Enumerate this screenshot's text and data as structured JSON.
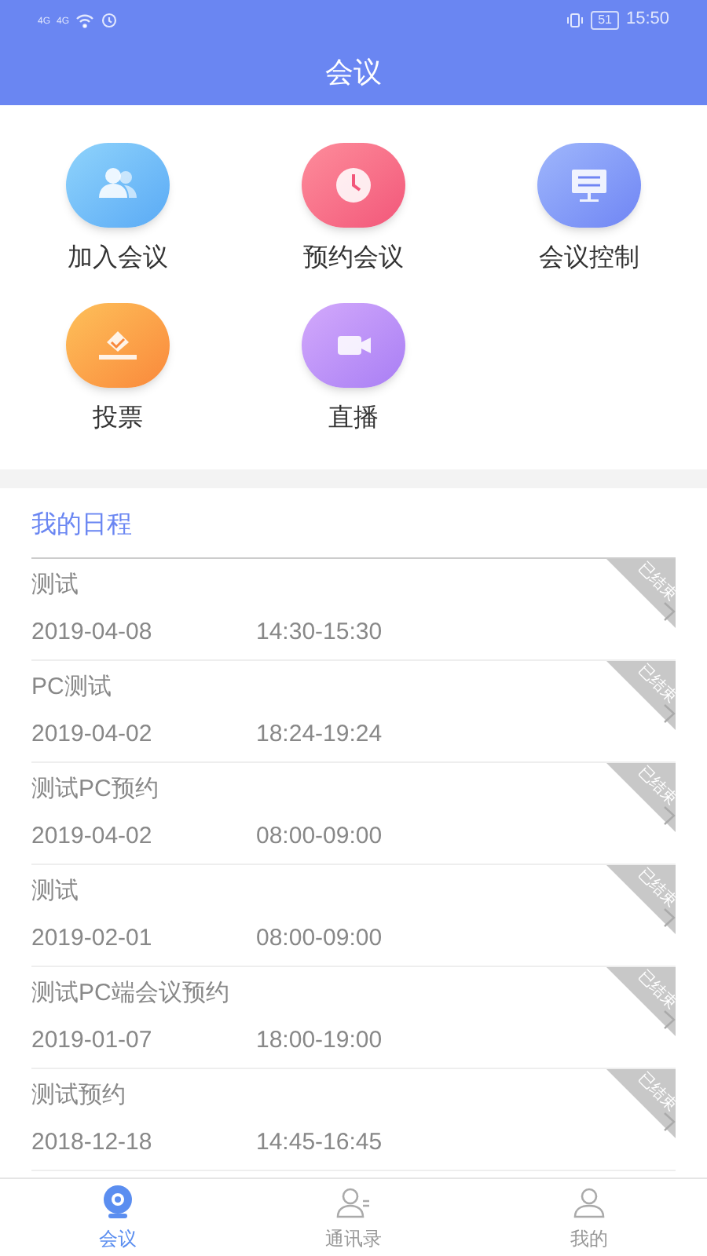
{
  "status_bar": {
    "signal_labels": [
      "4G",
      "4G"
    ],
    "battery": "51",
    "time": "15:50"
  },
  "title": "会议",
  "functions": [
    {
      "label": "加入会议",
      "kind": "people"
    },
    {
      "label": "预约会议",
      "kind": "clock"
    },
    {
      "label": "会议控制",
      "kind": "control"
    },
    {
      "label": "投票",
      "kind": "vote"
    },
    {
      "label": "直播",
      "kind": "video"
    }
  ],
  "schedule": {
    "heading": "我的日程",
    "items": [
      {
        "title": "测试",
        "date": "2019-04-08",
        "time": "14:30-15:30",
        "badge": "已结束"
      },
      {
        "title": "PC测试",
        "date": "2019-04-02",
        "time": "18:24-19:24",
        "badge": "已结束"
      },
      {
        "title": "测试PC预约",
        "date": "2019-04-02",
        "time": "08:00-09:00",
        "badge": "已结束"
      },
      {
        "title": "测试",
        "date": "2019-02-01",
        "time": "08:00-09:00",
        "badge": "已结束"
      },
      {
        "title": "测试PC端会议预约",
        "date": "2019-01-07",
        "time": "18:00-19:00",
        "badge": "已结束"
      },
      {
        "title": "测试预约",
        "date": "2018-12-18",
        "time": "14:45-16:45",
        "badge": "已结束"
      }
    ]
  },
  "tab_bar": [
    {
      "label": "会议",
      "kind": "meeting",
      "selected": true
    },
    {
      "label": "通讯录",
      "kind": "contacts",
      "selected": false
    },
    {
      "label": "我的",
      "kind": "me",
      "selected": false
    }
  ]
}
